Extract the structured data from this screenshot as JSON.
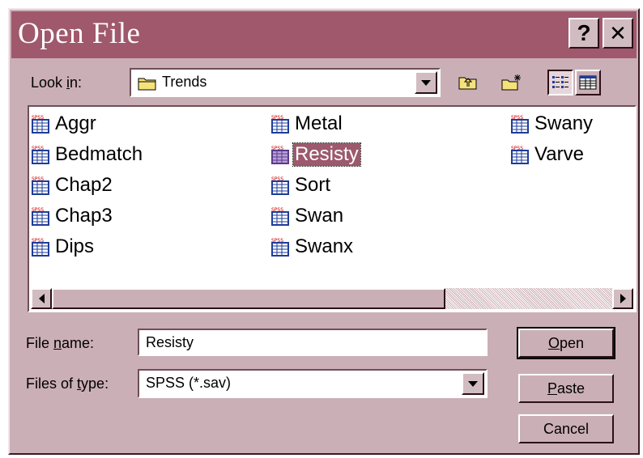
{
  "window": {
    "title": "Open File",
    "help_symbol": "?",
    "close_symbol": "✕"
  },
  "look_in": {
    "label_pre": "Look ",
    "label_mnemonic": "i",
    "label_post": "n:",
    "value": "Trends"
  },
  "files": [
    {
      "name": "Aggr",
      "selected": false
    },
    {
      "name": "Bedmatch",
      "selected": false
    },
    {
      "name": "Chap2",
      "selected": false
    },
    {
      "name": "Chap3",
      "selected": false
    },
    {
      "name": "Dips",
      "selected": false
    },
    {
      "name": "Metal",
      "selected": false
    },
    {
      "name": "Resisty",
      "selected": true
    },
    {
      "name": "Sort",
      "selected": false
    },
    {
      "name": "Swan",
      "selected": false
    },
    {
      "name": "Swanx",
      "selected": false
    },
    {
      "name": "Swany",
      "selected": false
    },
    {
      "name": "Varve",
      "selected": false
    }
  ],
  "file_name": {
    "label_pre": "File ",
    "label_mnemonic": "n",
    "label_post": "ame:",
    "value": "Resisty"
  },
  "file_type": {
    "label_pre": "Files of ",
    "label_mnemonic": "t",
    "label_post": "ype:",
    "value": "SPSS (*.sav)"
  },
  "buttons": {
    "open_mnemonic": "O",
    "open_rest": "pen",
    "paste_mnemonic": "P",
    "paste_rest": "aste",
    "cancel": "Cancel"
  },
  "colors": {
    "titlebar": "#a0586c",
    "dialog_face": "#cbafb7",
    "selection": "#9c5a6c"
  }
}
